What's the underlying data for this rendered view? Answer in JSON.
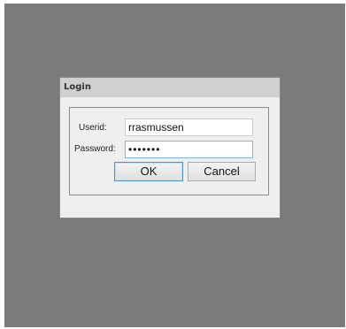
{
  "dialog": {
    "title": "Login",
    "userid_label": "Userid:",
    "userid_value": "rrasmussen",
    "password_label": "Password:",
    "password_value": "•••••••",
    "ok_label": "OK",
    "cancel_label": "Cancel"
  },
  "colors": {
    "screen_background": "#7b7b7b",
    "dialog_background": "#efefef",
    "titlebar": "#d0d0d0",
    "focus_border": "#4a90d0"
  }
}
